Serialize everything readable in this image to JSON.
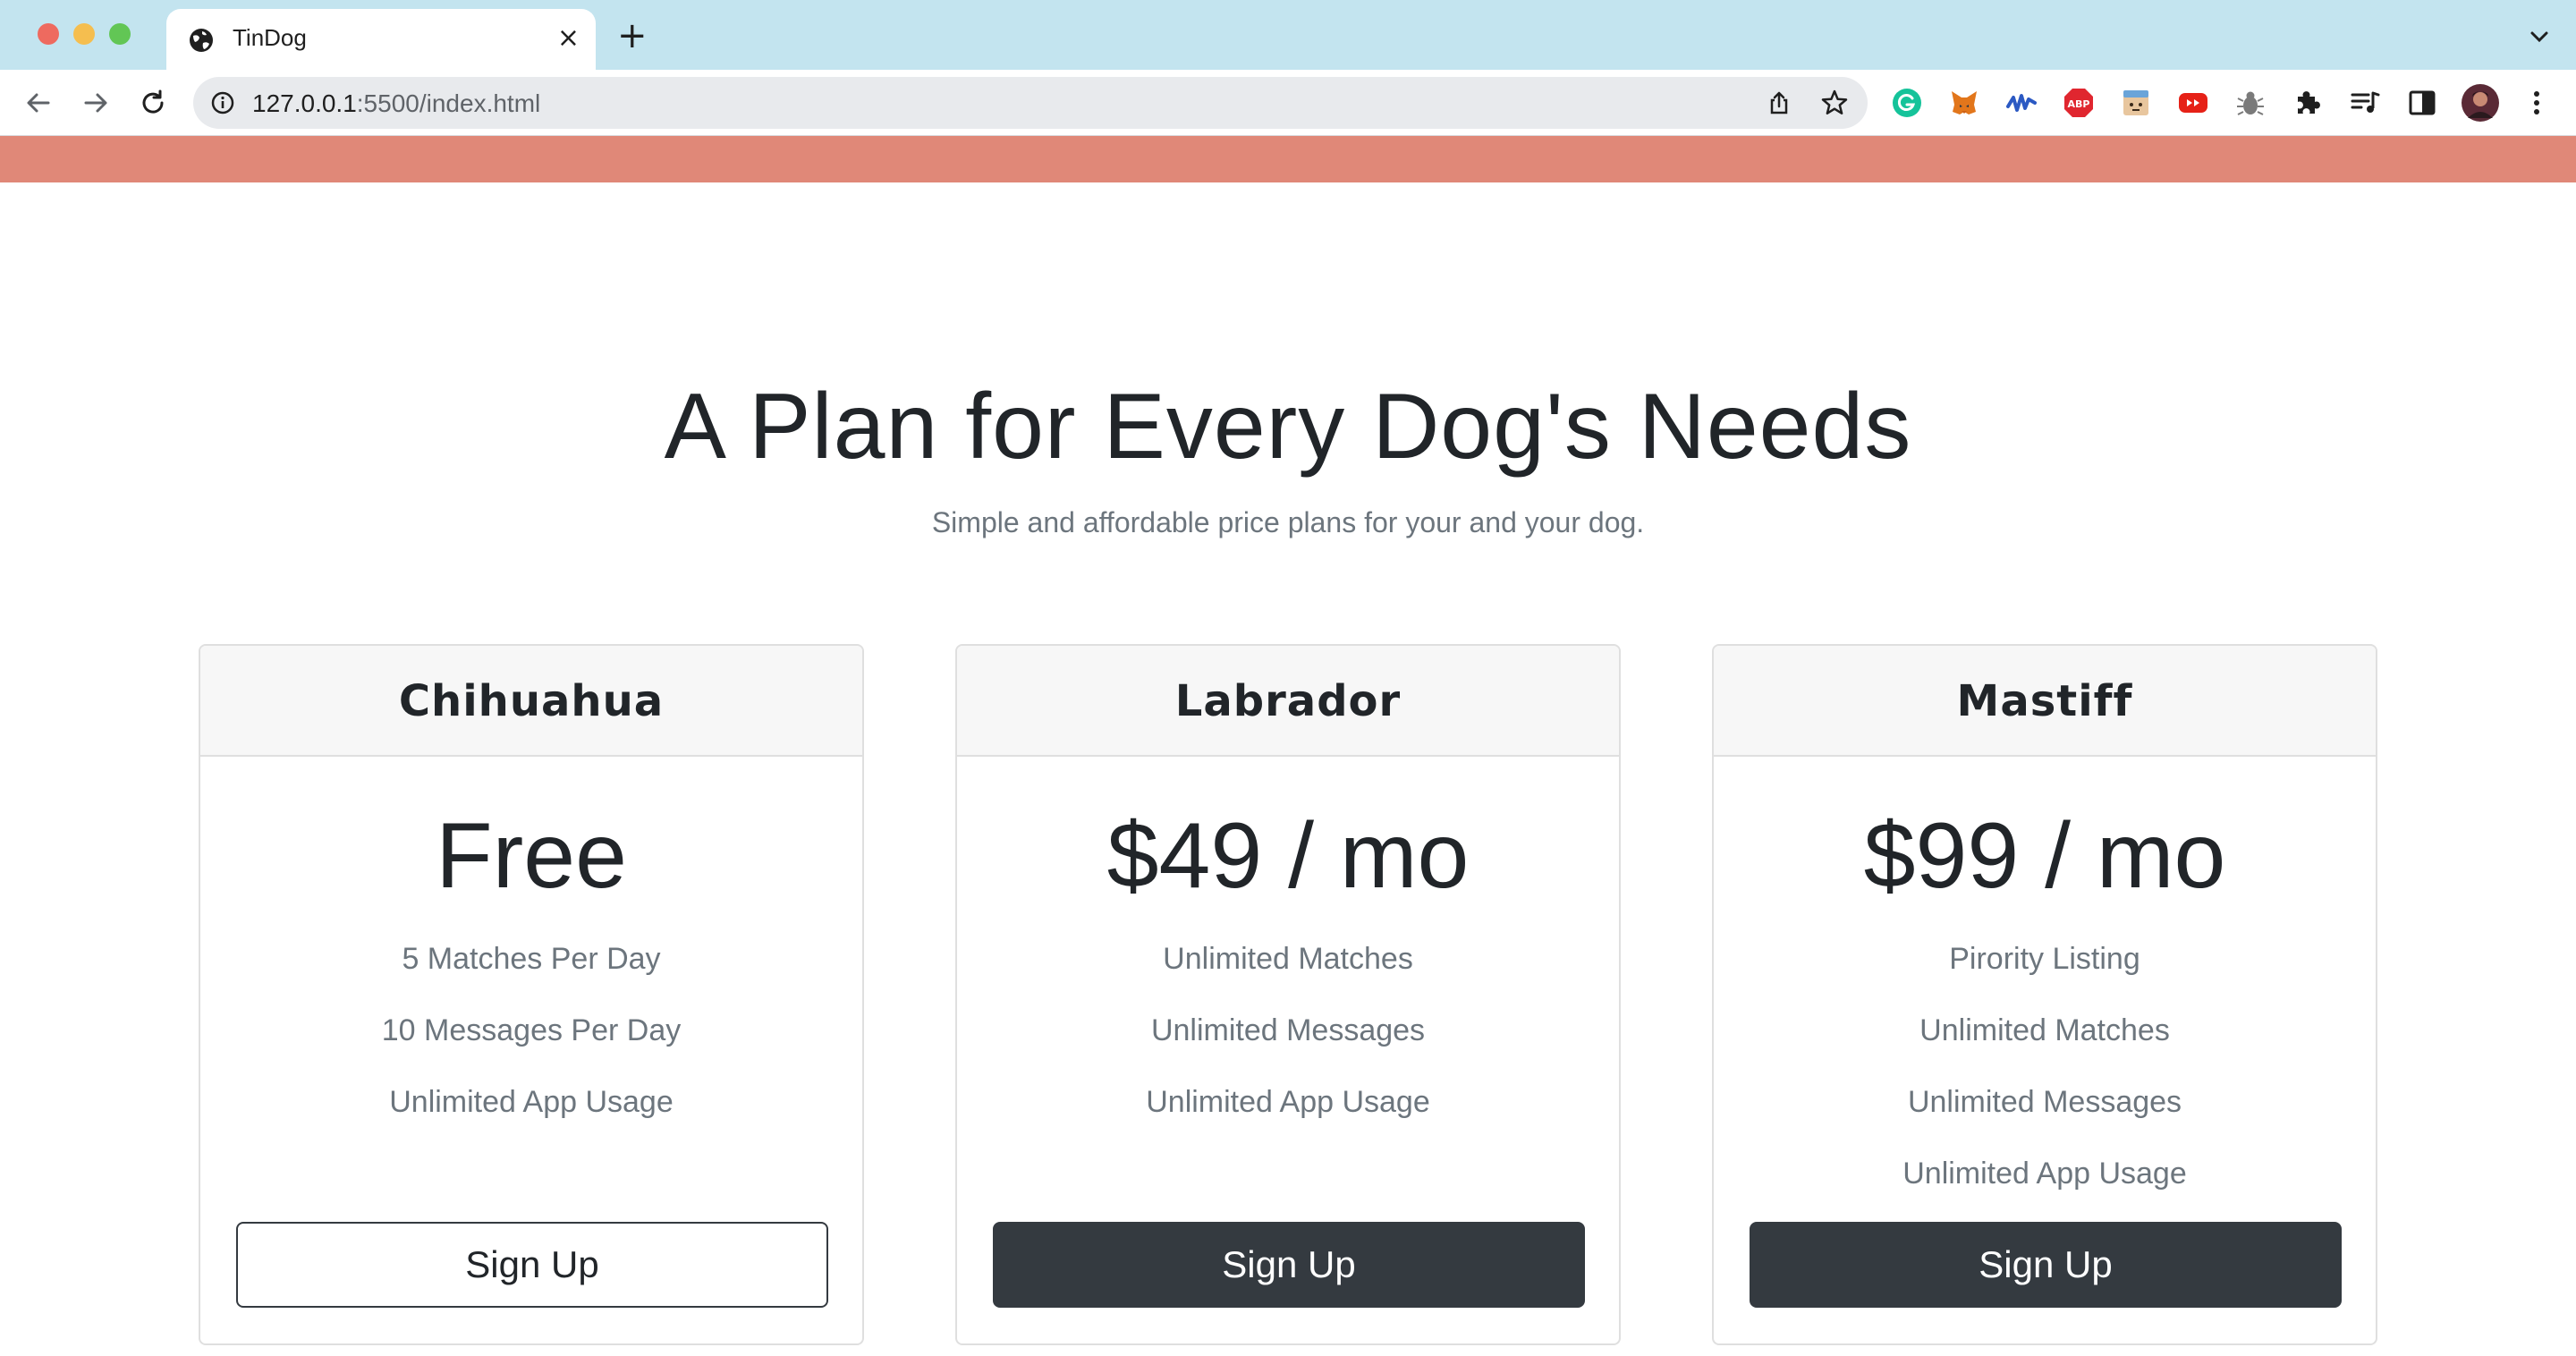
{
  "browser": {
    "tab_title": "TinDog",
    "new_tab_symbol": "+",
    "close_symbol": "×",
    "url_host": "127.0.0.1",
    "url_path": ":5500/index.html",
    "extensions": [
      "grammarly-icon",
      "metamask-icon",
      "wave-icon",
      "adblock-plus-icon",
      "extension-box-icon",
      "youtube-icon",
      "bug-icon",
      "puzzle-icon",
      "media-controls-icon",
      "side-panel-icon",
      "profile-avatar",
      "kebab-menu-icon"
    ]
  },
  "pricing": {
    "title": "A Plan for Every Dog's Needs",
    "subtitle": "Simple and affordable price plans for your and your dog.",
    "plans": [
      {
        "name": "Chihuahua",
        "price": "Free",
        "features": [
          "5 Matches Per Day",
          "10 Messages Per Day",
          "Unlimited App Usage"
        ],
        "button_label": "Sign Up",
        "button_style": "outline"
      },
      {
        "name": "Labrador",
        "price": "$49 / mo",
        "features": [
          "Unlimited Matches",
          "Unlimited Messages",
          "Unlimited App Usage"
        ],
        "button_label": "Sign Up",
        "button_style": "dark"
      },
      {
        "name": "Mastiff",
        "price": "$99 / mo",
        "features": [
          "Pirority Listing",
          "Unlimited Matches",
          "Unlimited Messages",
          "Unlimited App Usage"
        ],
        "button_label": "Sign Up",
        "button_style": "dark"
      }
    ]
  },
  "colors": {
    "hero_strip": "#e08878",
    "dark_button": "#343a40",
    "card_header_bg": "#f7f7f7",
    "tabbar_bg": "#c3e4ef"
  }
}
